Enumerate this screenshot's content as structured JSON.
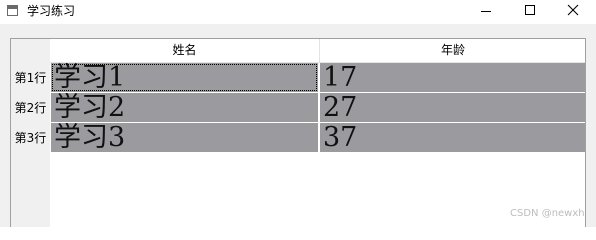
{
  "window": {
    "title": "学习练习",
    "icons": {
      "app": "window-app-icon",
      "minimize": "minimize-icon",
      "maximize": "maximize-icon",
      "close": "close-icon"
    }
  },
  "table": {
    "columns": [
      "姓名",
      "年龄"
    ],
    "rows": [
      {
        "header": "第1行",
        "name": "学习1",
        "age": "17"
      },
      {
        "header": "第2行",
        "name": "学习2",
        "age": "27"
      },
      {
        "header": "第3行",
        "name": "学习3",
        "age": "37"
      }
    ],
    "selected_color": "#9b9a9f"
  },
  "watermark": "CSDN @newxh"
}
